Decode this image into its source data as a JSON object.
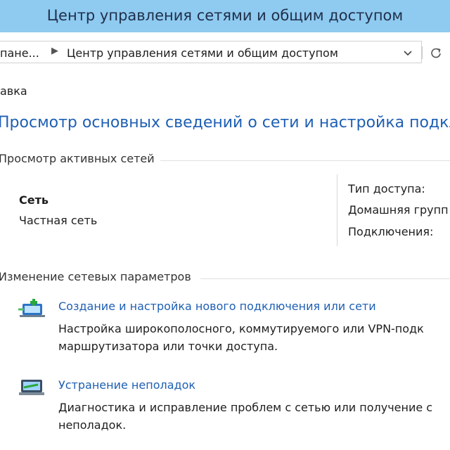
{
  "window": {
    "title": "Центр управления сетями и общим доступом"
  },
  "address": {
    "crumb_parent": "пане...",
    "crumb_current": "Центр управления сетями и общим доступом"
  },
  "menu": {
    "help": "авка"
  },
  "main": {
    "heading": "Просмотр основных сведений о сети и настройка подкл",
    "active_networks": {
      "title": "Просмотр активных сетей",
      "network_name": "Сеть",
      "network_category": "Частная сеть",
      "access_type_label": "Тип доступа:",
      "homegroup_label": "Домашняя групп",
      "connections_label": "Подключения:"
    },
    "change_settings": {
      "title": "Изменение сетевых параметров",
      "tasks": [
        {
          "link": "Создание и настройка нового подключения или сети",
          "desc_line1": "Настройка широкополосного, коммутируемого или VPN-подк",
          "desc_line2": "маршрутизатора или точки доступа.",
          "icon": "network-new-connection-icon"
        },
        {
          "link": "Устранение неполадок",
          "desc_line1": "Диагностика и исправление проблем с сетью или получение с",
          "desc_line2": "неполадок.",
          "icon": "network-troubleshoot-icon"
        }
      ]
    }
  }
}
